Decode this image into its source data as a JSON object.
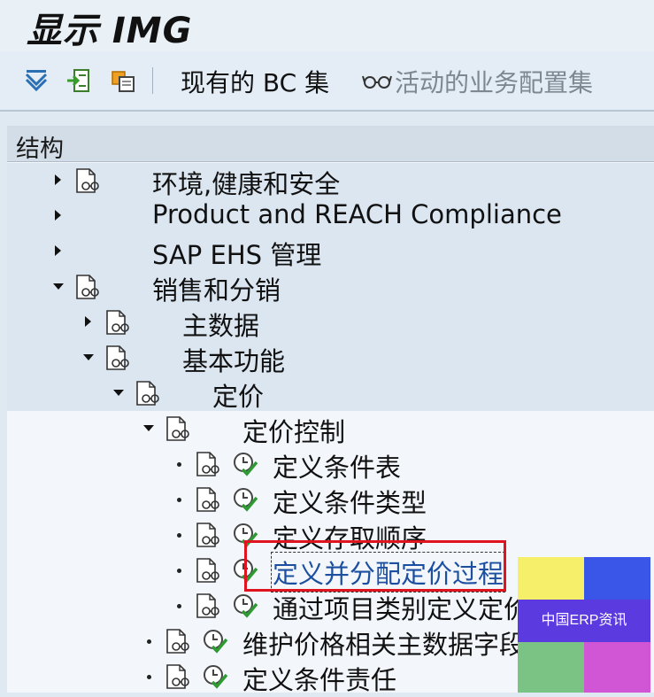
{
  "window": {
    "title": "显示 IMG"
  },
  "toolbar": {
    "bc_sets_label": "现有的 BC 集",
    "active_sets_label": "活动的业务配置集",
    "icons": [
      "expand-all-icon",
      "position-icon",
      "where-used-icon"
    ]
  },
  "structure": {
    "header": "结构",
    "rows": [
      {
        "label": "环境,健康和安全",
        "expander": "collapsed",
        "doc": true,
        "clock": false
      },
      {
        "label": "Product and REACH Compliance",
        "expander": "collapsed",
        "doc": false,
        "clock": false
      },
      {
        "label": "SAP EHS 管理",
        "expander": "collapsed",
        "doc": false,
        "clock": false
      },
      {
        "label": "销售和分销",
        "expander": "expanded",
        "doc": true,
        "clock": false
      },
      {
        "label": "主数据",
        "expander": "collapsed",
        "doc": true,
        "clock": false
      },
      {
        "label": "基本功能",
        "expander": "expanded",
        "doc": true,
        "clock": false
      },
      {
        "label": "定价",
        "expander": "expanded",
        "doc": true,
        "clock": false
      },
      {
        "label": "定价控制",
        "expander": "expanded",
        "doc": true,
        "clock": false
      },
      {
        "label": "定义条件表",
        "expander": "leaf",
        "doc": true,
        "clock": true
      },
      {
        "label": "定义条件类型",
        "expander": "leaf",
        "doc": true,
        "clock": true
      },
      {
        "label": "定义存取顺序",
        "expander": "leaf",
        "doc": true,
        "clock": true
      },
      {
        "label": "定义并分配定价过程",
        "expander": "leaf",
        "doc": true,
        "clock": true
      },
      {
        "label": "通过项目类别定义定价",
        "expander": "leaf",
        "doc": true,
        "clock": true
      },
      {
        "label": "维护价格相关主数据字段",
        "expander": "leaf",
        "doc": true,
        "clock": true
      },
      {
        "label": "定义条件责任",
        "expander": "leaf",
        "doc": true,
        "clock": true
      }
    ]
  },
  "watermark": {
    "text": "中国ERP资讯",
    "colors": [
      "#f6ef6a",
      "#3a56e8",
      "#5b3be0",
      "#7ac385",
      "#d056d6"
    ]
  },
  "colors": {
    "highlight_box": "#e0141e",
    "link_text": "#1c4fa0"
  }
}
